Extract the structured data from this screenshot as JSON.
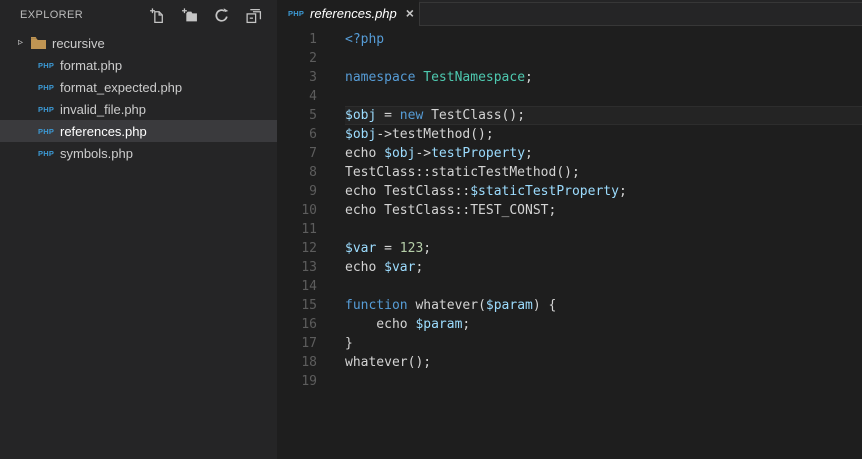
{
  "icons": {
    "php_badge": "PHP",
    "chevron": "▹",
    "close": "×"
  },
  "sidebar": {
    "title": "EXPLORER",
    "actions": [
      {
        "name": "new-file"
      },
      {
        "name": "new-folder"
      },
      {
        "name": "refresh"
      },
      {
        "name": "collapse-all"
      }
    ],
    "folder": {
      "name": "recursive",
      "expanded": false
    },
    "files": [
      {
        "name": "format.php",
        "selected": false
      },
      {
        "name": "format_expected.php",
        "selected": false
      },
      {
        "name": "invalid_file.php",
        "selected": false
      },
      {
        "name": "references.php",
        "selected": true
      },
      {
        "name": "symbols.php",
        "selected": false
      }
    ]
  },
  "tab": {
    "label": "references.php"
  },
  "editor": {
    "language": "php",
    "current_line": 5,
    "token_colors": {
      "kw": "#569cd6",
      "type": "#4ec9b0",
      "var": "#9cdcfe",
      "num": "#b5cea8",
      "fg": "#d4d4d4"
    },
    "lines": [
      {
        "num": 1,
        "segments": [
          [
            "<?php",
            "kw"
          ]
        ]
      },
      {
        "num": 2,
        "segments": []
      },
      {
        "num": 3,
        "segments": [
          [
            "namespace ",
            "kw"
          ],
          [
            "TestNamespace",
            "type"
          ],
          [
            ";",
            "fg"
          ]
        ]
      },
      {
        "num": 4,
        "segments": []
      },
      {
        "num": 5,
        "segments": [
          [
            "$obj",
            "var"
          ],
          [
            " = ",
            "fg"
          ],
          [
            "new",
            "kw"
          ],
          [
            " TestClass();",
            "fg"
          ]
        ]
      },
      {
        "num": 6,
        "segments": [
          [
            "$obj",
            "var"
          ],
          [
            "->testMethod();",
            "fg"
          ]
        ]
      },
      {
        "num": 7,
        "segments": [
          [
            "echo ",
            "fg"
          ],
          [
            "$obj",
            "var"
          ],
          [
            "->",
            "fg"
          ],
          [
            "testProperty",
            "var"
          ],
          [
            ";",
            "fg"
          ]
        ]
      },
      {
        "num": 8,
        "segments": [
          [
            "TestClass::staticTestMethod();",
            "fg"
          ]
        ]
      },
      {
        "num": 9,
        "segments": [
          [
            "echo TestClass::",
            "fg"
          ],
          [
            "$staticTestProperty",
            "var"
          ],
          [
            ";",
            "fg"
          ]
        ]
      },
      {
        "num": 10,
        "segments": [
          [
            "echo TestClass::TEST_CONST;",
            "fg"
          ]
        ]
      },
      {
        "num": 11,
        "segments": []
      },
      {
        "num": 12,
        "segments": [
          [
            "$var",
            "var"
          ],
          [
            " = ",
            "fg"
          ],
          [
            "123",
            "num"
          ],
          [
            ";",
            "fg"
          ]
        ]
      },
      {
        "num": 13,
        "segments": [
          [
            "echo ",
            "fg"
          ],
          [
            "$var",
            "var"
          ],
          [
            ";",
            "fg"
          ]
        ]
      },
      {
        "num": 14,
        "segments": []
      },
      {
        "num": 15,
        "segments": [
          [
            "function",
            "kw"
          ],
          [
            " whatever(",
            "fg"
          ],
          [
            "$param",
            "var"
          ],
          [
            ") {",
            "fg"
          ]
        ]
      },
      {
        "num": 16,
        "segments": [
          [
            "    echo ",
            "fg"
          ],
          [
            "$param",
            "var"
          ],
          [
            ";",
            "fg"
          ]
        ]
      },
      {
        "num": 17,
        "segments": [
          [
            "}",
            "fg"
          ]
        ]
      },
      {
        "num": 18,
        "segments": [
          [
            "whatever();",
            "fg"
          ]
        ]
      },
      {
        "num": 19,
        "segments": []
      }
    ]
  }
}
